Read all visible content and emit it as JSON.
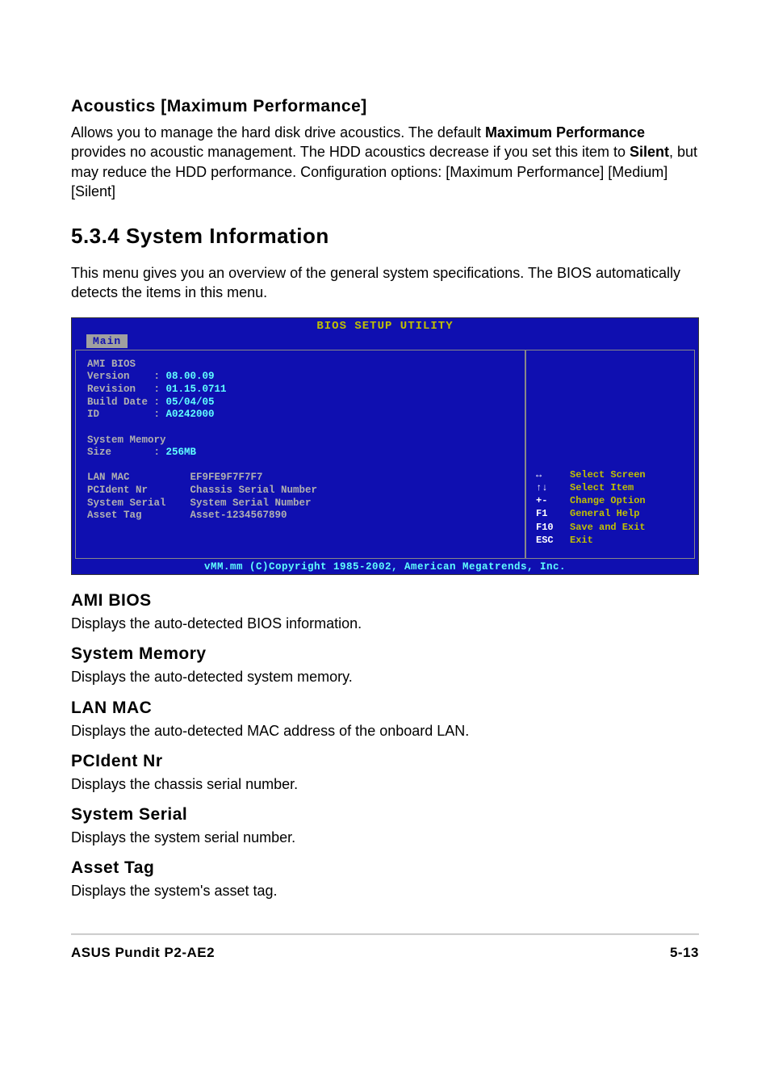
{
  "acoustics": {
    "title": "Acoustics [Maximum Performance]",
    "para_pre": "Allows you to manage the hard disk drive acoustics. The default ",
    "bold1": "Maximum Performance",
    "para_mid1": " provides no acoustic management. The HDD acoustics decrease if you set this item to ",
    "bold2": "Silent",
    "para_end": ", but may reduce the HDD performance. Configuration options: [Maximum Performance] [Medium] [Silent]"
  },
  "section": {
    "num_title": "5.3.4   System Information",
    "intro": "This menu gives you an overview of the general system specifications. The BIOS automatically detects the items in this menu."
  },
  "bios": {
    "header": "BIOS SETUP UTILITY",
    "tab": "Main",
    "rows": {
      "l1": "AMI BIOS",
      "l2a": "Version    : ",
      "l2b": "08.00.09",
      "l3a": "Revision   : ",
      "l3b": "01.15.0711",
      "l4a": "Build Date : ",
      "l4b": "05/04/05",
      "l5a": "ID         : ",
      "l5b": "A0242000",
      "l6": "",
      "l7": "System Memory",
      "l8a": "Size       : ",
      "l8b": "256MB",
      "l9": "",
      "l10": "LAN MAC          EF9FE9F7F7F7",
      "l11": "PCIdent Nr       Chassis Serial Number",
      "l12": "System Serial    System Serial Number",
      "l13": "Asset Tag        Asset-1234567890"
    },
    "help": [
      {
        "key": "↔",
        "txt": "Select Screen"
      },
      {
        "key": "↑↓",
        "txt": "Select Item"
      },
      {
        "key": "+-",
        "txt": "Change Option"
      },
      {
        "key": "F1",
        "txt": "General Help"
      },
      {
        "key": "F10",
        "txt": "Save and Exit"
      },
      {
        "key": "ESC",
        "txt": "Exit"
      }
    ],
    "footer": "vMM.mm (C)Copyright 1985-2002, American Megatrends, Inc."
  },
  "subsections": [
    {
      "title": "AMI BIOS",
      "desc": "Displays the auto-detected BIOS information."
    },
    {
      "title": "System Memory",
      "desc": "Displays the auto-detected system memory."
    },
    {
      "title": "LAN MAC",
      "desc": "Displays the auto-detected MAC address of the onboard LAN."
    },
    {
      "title": "PCIdent Nr",
      "desc": "Displays the chassis serial number."
    },
    {
      "title": "System Serial",
      "desc": "Displays the system serial number."
    },
    {
      "title": "Asset Tag",
      "desc": "Displays the system's asset tag."
    }
  ],
  "footer": {
    "left": "ASUS Pundit P2-AE2",
    "right": "5-13"
  }
}
